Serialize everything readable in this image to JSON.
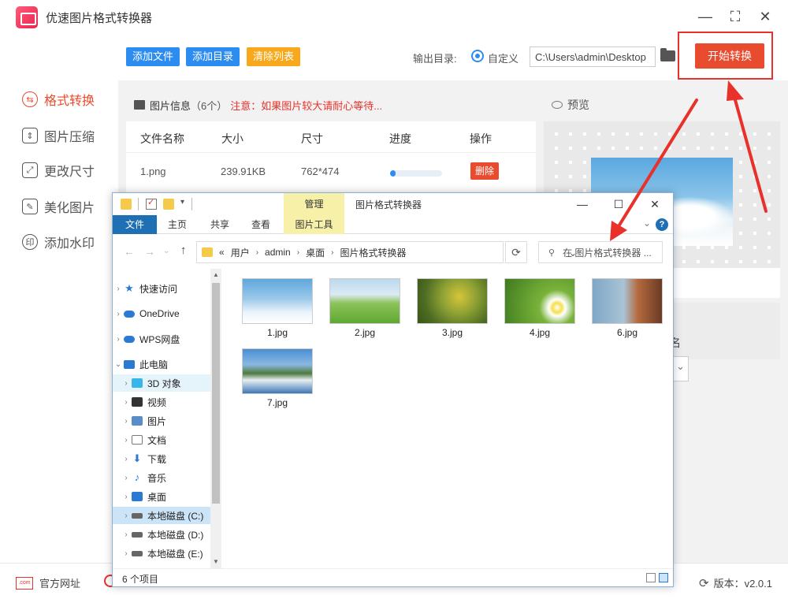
{
  "app": {
    "title": "优速图片格式转换器",
    "window_controls": [
      "minimize",
      "maximize",
      "close"
    ]
  },
  "sidebar": {
    "items": [
      {
        "label": "格式转换",
        "icon": "format-convert-icon",
        "active": true
      },
      {
        "label": "图片压缩",
        "icon": "compress-icon",
        "active": false
      },
      {
        "label": "更改尺寸",
        "icon": "resize-icon",
        "active": false
      },
      {
        "label": "美化图片",
        "icon": "beautify-icon",
        "active": false
      },
      {
        "label": "添加水印",
        "icon": "watermark-icon",
        "active": false
      }
    ]
  },
  "toolbar": {
    "add_file": "添加文件",
    "add_folder": "添加目录",
    "clear_list": "清除列表",
    "output_label": "输出目录:",
    "output_option": "自定义",
    "output_path": "C:\\Users\\admin\\Desktop",
    "start_button": "开始转换",
    "accent_color": "#e94b2e",
    "primary_color": "#2d8cf0"
  },
  "file_list": {
    "title": "图片信息",
    "count": "（6个）",
    "warning": "注意：如果图片较大请耐心等待...",
    "columns": [
      "文件名称",
      "大小",
      "尺寸",
      "进度",
      "操作"
    ],
    "rows": [
      {
        "name": "1.png",
        "size": "239.91KB",
        "dimensions": "762*474",
        "progress": 0.1,
        "action": "删除"
      }
    ]
  },
  "preview": {
    "title": "预览",
    "partial_label": "名"
  },
  "statusbar": {
    "site_link": "官方网址",
    "site_badge": ".com",
    "version": "版本：v2.0.1"
  },
  "explorer": {
    "title": "图片格式转换器",
    "manage_tab": "管理",
    "ribbon_tabs": [
      "文件",
      "主页",
      "共享",
      "查看",
      "图片工具"
    ],
    "address": [
      "«",
      "用户",
      "admin",
      "桌面",
      "图片格式转换器"
    ],
    "search_placeholder": "在 图片格式转换器 ...",
    "tree": [
      {
        "label": "快速访问",
        "icon": "quick-access-icon",
        "level": 0
      },
      {
        "label": "OneDrive",
        "icon": "onedrive-icon",
        "level": 0
      },
      {
        "label": "WPS网盘",
        "icon": "wps-cloud-icon",
        "level": 0
      },
      {
        "label": "此电脑",
        "icon": "this-pc-icon",
        "level": 0,
        "expanded": true
      },
      {
        "label": "3D 对象",
        "icon": "3d-objects-icon",
        "level": 1
      },
      {
        "label": "视频",
        "icon": "videos-icon",
        "level": 1
      },
      {
        "label": "图片",
        "icon": "pictures-icon",
        "level": 1
      },
      {
        "label": "文档",
        "icon": "documents-icon",
        "level": 1
      },
      {
        "label": "下载",
        "icon": "downloads-icon",
        "level": 1
      },
      {
        "label": "音乐",
        "icon": "music-icon",
        "level": 1
      },
      {
        "label": "桌面",
        "icon": "desktop-icon",
        "level": 1
      },
      {
        "label": "本地磁盘 (C:)",
        "icon": "drive-icon",
        "level": 1,
        "selected": true
      },
      {
        "label": "本地磁盘 (D:)",
        "icon": "drive-icon",
        "level": 1
      },
      {
        "label": "本地磁盘 (E:)",
        "icon": "drive-icon",
        "level": 1
      }
    ],
    "files": [
      {
        "name": "1.jpg",
        "thumb": "sky-clouds"
      },
      {
        "name": "2.jpg",
        "thumb": "green-field"
      },
      {
        "name": "3.jpg",
        "thumb": "yellow-flowers"
      },
      {
        "name": "4.jpg",
        "thumb": "daisies"
      },
      {
        "name": "6.jpg",
        "thumb": "lake-house"
      },
      {
        "name": "7.jpg",
        "thumb": "coast-town"
      }
    ],
    "status": "6 个项目"
  }
}
